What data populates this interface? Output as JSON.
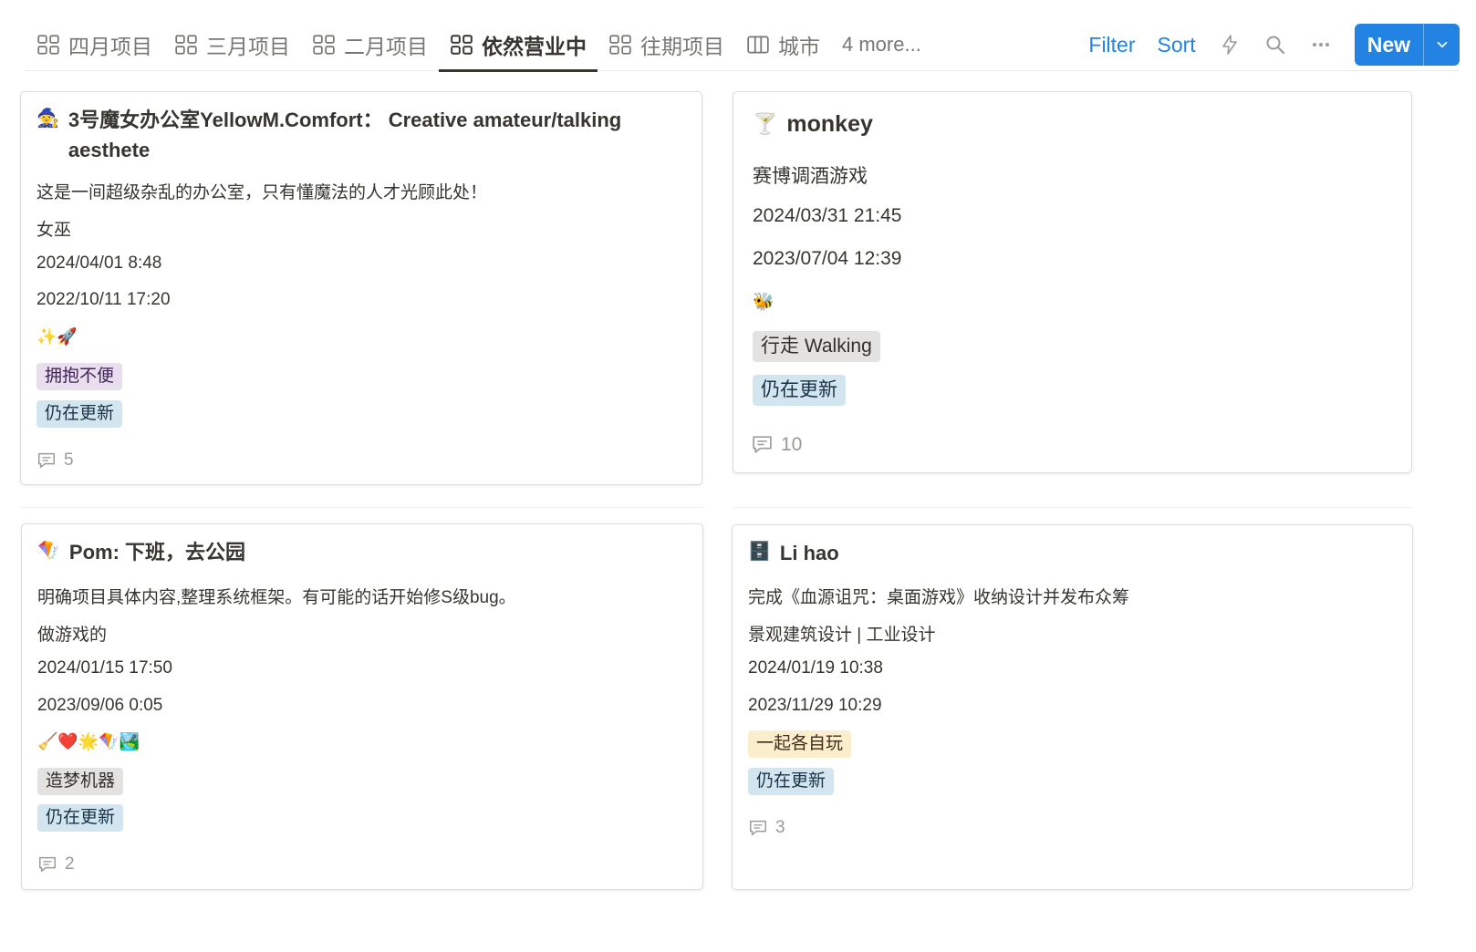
{
  "tabs": [
    {
      "label": "四月项目",
      "icon": "gallery-icon"
    },
    {
      "label": "三月项目",
      "icon": "gallery-icon"
    },
    {
      "label": "二月项目",
      "icon": "gallery-icon"
    },
    {
      "label": "依然营业中",
      "icon": "gallery-icon",
      "active": true
    },
    {
      "label": "往期项目",
      "icon": "gallery-icon"
    },
    {
      "label": "城市",
      "icon": "board-icon"
    },
    {
      "label": "4 more..."
    }
  ],
  "actions": {
    "filter": "Filter",
    "sort": "Sort",
    "new": "New"
  },
  "colors": {
    "accent": "#2383e2",
    "text": "#37352f",
    "muted": "#787774"
  },
  "cards": [
    {
      "icon": "🧙",
      "title": "3号魔女办公室YellowM.Comfort： Creative amateur/talking aesthete",
      "description": "这是一间超级杂乱的办公室，只有懂魔法的人才光顾此处！",
      "role": "女巫",
      "updated": "2024/04/01 8:48",
      "created": "2022/10/11 17:20",
      "emojis": "✨🚀",
      "tags": [
        {
          "label": "拥抱不便",
          "color": "purple"
        },
        {
          "label": "仍在更新",
          "color": "blue"
        }
      ],
      "comments": "5"
    },
    {
      "icon": "🍸",
      "title": "monkey",
      "description": "赛博调酒游戏",
      "updated": "2024/03/31 21:45",
      "created": "2023/07/04 12:39",
      "emojis": "🐝",
      "tags": [
        {
          "label": "行走 Walking",
          "color": "gray"
        },
        {
          "label": "仍在更新",
          "color": "blue"
        }
      ],
      "comments": "10"
    },
    {
      "icon": "🪁",
      "title": "Pom: 下班，去公园",
      "description": "明确项目具体内容,整理系统框架。有可能的话开始修S级bug。",
      "role": "做游戏的",
      "updated": "2024/01/15 17:50",
      "created": "2023/09/06 0:05",
      "emojis": "🧹❤️🌟🪁🏞️",
      "tags": [
        {
          "label": "造梦机器",
          "color": "gray"
        },
        {
          "label": "仍在更新",
          "color": "blue"
        }
      ],
      "comments": "2"
    },
    {
      "icon": "🗄️",
      "title": "Li hao",
      "description": "完成《血源诅咒：桌面游戏》收纳设计并发布众筹",
      "role": "景观建筑设计 | 工业设计",
      "updated": "2024/01/19 10:38",
      "created": "2023/11/29 10:29",
      "tags": [
        {
          "label": "一起各自玩",
          "color": "yellow"
        },
        {
          "label": "仍在更新",
          "color": "blue"
        }
      ],
      "comments": "3"
    }
  ]
}
